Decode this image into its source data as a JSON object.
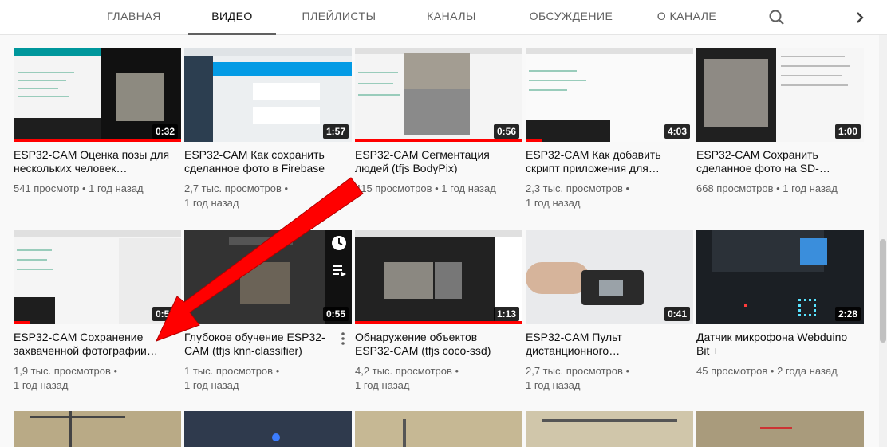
{
  "tabs": {
    "home": "ГЛАВНАЯ",
    "video": "ВИДЕО",
    "playlists": "ПЛЕЙЛИСТЫ",
    "channels": "КАНАЛЫ",
    "discussion": "ОБСУЖДЕНИЕ",
    "about": "О КАНАЛЕ",
    "active": "video"
  },
  "icons": {
    "search": "search-icon",
    "next": "chevron-right-icon",
    "watch_later": "clock-icon",
    "add_queue": "playlist-add-icon",
    "more": "more-vert-icon"
  },
  "colors": {
    "progress": "#ff0000",
    "arrow": "#ff0000"
  },
  "videos": [
    {
      "title": "ESP32-CAM Оценка позы для нескольких человек…",
      "views": "541 просмотр",
      "age": "1 год назад",
      "duration": "0:32",
      "watched": 1.0
    },
    {
      "title": "ESP32-CAM Как сохранить сделанное фото в Firebase",
      "views": "2,7 тыс. просмотров",
      "age": "1 год назад",
      "duration": "1:57",
      "watched": 0
    },
    {
      "title": "ESP32-CAM Сегментация людей (tfjs BodyPix)",
      "views": "415 просмотров",
      "age": "1 год назад",
      "duration": "0:56",
      "watched": 1.0
    },
    {
      "title": "ESP32-CAM Как добавить скрипт приложения для…",
      "views": "2,3 тыс. просмотров",
      "age": "1 год назад",
      "duration": "4:03",
      "watched": 0.1
    },
    {
      "title": "ESP32-CAM Сохранить сделанное фото на SD-…",
      "views": "668 просмотров",
      "age": "1 год назад",
      "duration": "1:00",
      "watched": 0
    },
    {
      "title": "ESP32-CAM Сохранение захваченной фотографии…",
      "views": "1,9 тыс. просмотров",
      "age": "1 год назад",
      "duration": "0:55",
      "watched": 0.1
    },
    {
      "title": "Глубокое обучение ESP32-CAM (tfjs knn-classifier)",
      "views": "1 тыс. просмотров",
      "age": "1 год назад",
      "duration": "0:55",
      "watched": 0
    },
    {
      "title": "Обнаружение объектов ESP32-CAM (tfjs coco-ssd)",
      "views": "4,2 тыс. просмотров",
      "age": "1 год назад",
      "duration": "1:13",
      "watched": 1.0
    },
    {
      "title": "ESP32-CAM Пульт дистанционного…",
      "views": "2,7 тыс. просмотров",
      "age": "1 год назад",
      "duration": "0:41",
      "watched": 0
    },
    {
      "title": "Датчик микрофона Webduino Bit +",
      "views": "45 просмотров",
      "age": "2 года назад",
      "duration": "2:28",
      "watched": 0
    }
  ]
}
